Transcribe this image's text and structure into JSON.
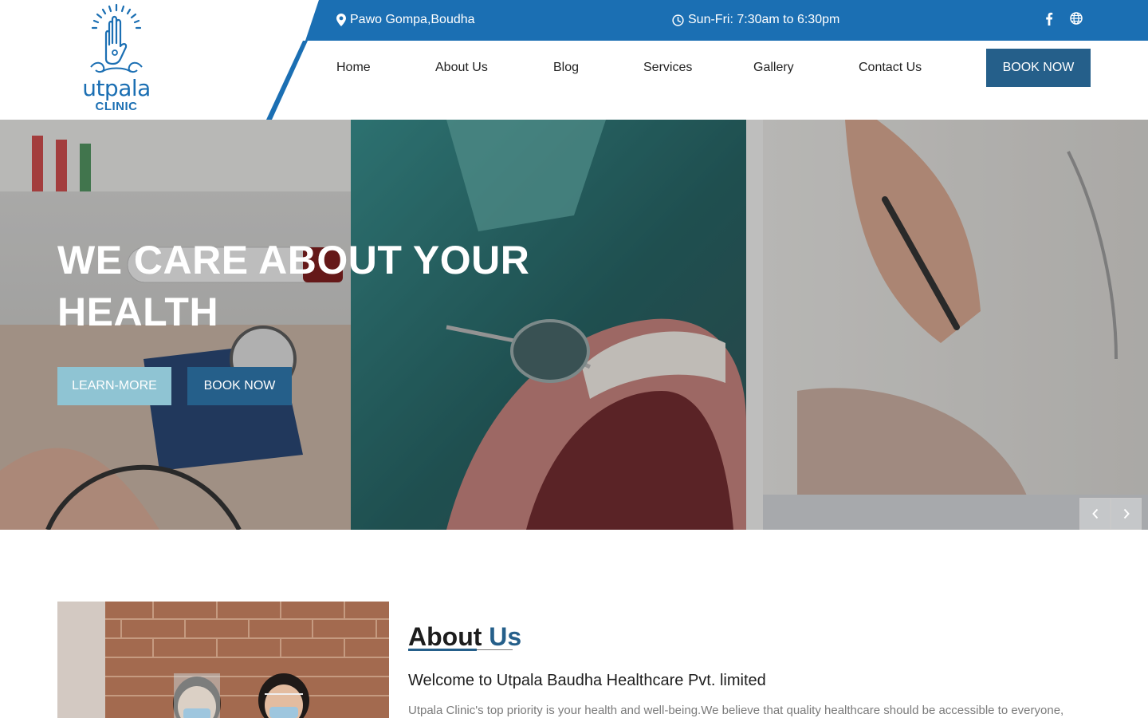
{
  "brand": {
    "name": "utpala",
    "sub": "CLINIC",
    "primary_color": "#1b6fb3",
    "dark_color": "#255f8a",
    "light_accent": "#8fc4d3"
  },
  "topbar": {
    "address_icon": "map-marker-icon",
    "address": "Pawo Gompa,Boudha",
    "hours_icon": "clock-icon",
    "hours": "Sun-Fri: 7:30am to 6:30pm",
    "social": [
      "facebook-icon",
      "globe-icon"
    ]
  },
  "nav": {
    "items": [
      "Home",
      "About Us",
      "Blog",
      "Services",
      "Gallery",
      "Contact Us"
    ],
    "cta": "BOOK NOW"
  },
  "hero": {
    "title": "WE CARE ABOUT YOUR HEALTH",
    "learn_more": "LEARN-MORE",
    "book_now": "BOOK NOW",
    "prev_icon": "chevron-left-icon",
    "next_icon": "chevron-right-icon"
  },
  "about": {
    "heading_word1": "About",
    "heading_word2": "Us",
    "subtitle": "Welcome to Utpala Baudha Healthcare Pvt. limited",
    "text": "Utpala Clinic's top priority is your health and well-being.We believe that quality healthcare should be accessible to everyone,"
  }
}
